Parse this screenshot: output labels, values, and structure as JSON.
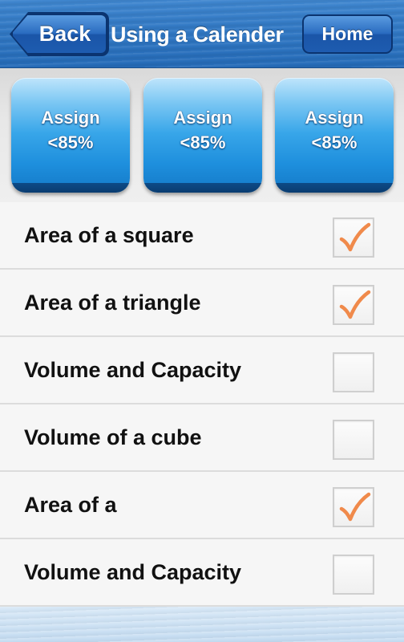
{
  "navbar": {
    "back_label": "Back",
    "title": "Using a Calender",
    "home_label": "Home"
  },
  "assign_buttons": [
    {
      "line1": "Assign",
      "line2": "<85%"
    },
    {
      "line1": "Assign",
      "line2": "<85%"
    },
    {
      "line1": "Assign",
      "line2": "<85%"
    }
  ],
  "topics": [
    {
      "label": "Area of a square",
      "checked": true
    },
    {
      "label": "Area of a triangle",
      "checked": true
    },
    {
      "label": "Volume and Capacity",
      "checked": false
    },
    {
      "label": "Volume of a cube",
      "checked": false
    },
    {
      "label": "Area of a",
      "checked": true
    },
    {
      "label": "Volume and Capacity",
      "checked": false
    }
  ],
  "colors": {
    "nav_blue": "#2f76c2",
    "assign_blue": "#1e8fdd",
    "check_orange": "#f08a4b"
  },
  "icons": {
    "back": "back-arrow-button",
    "checkmark": "checkmark-icon"
  }
}
